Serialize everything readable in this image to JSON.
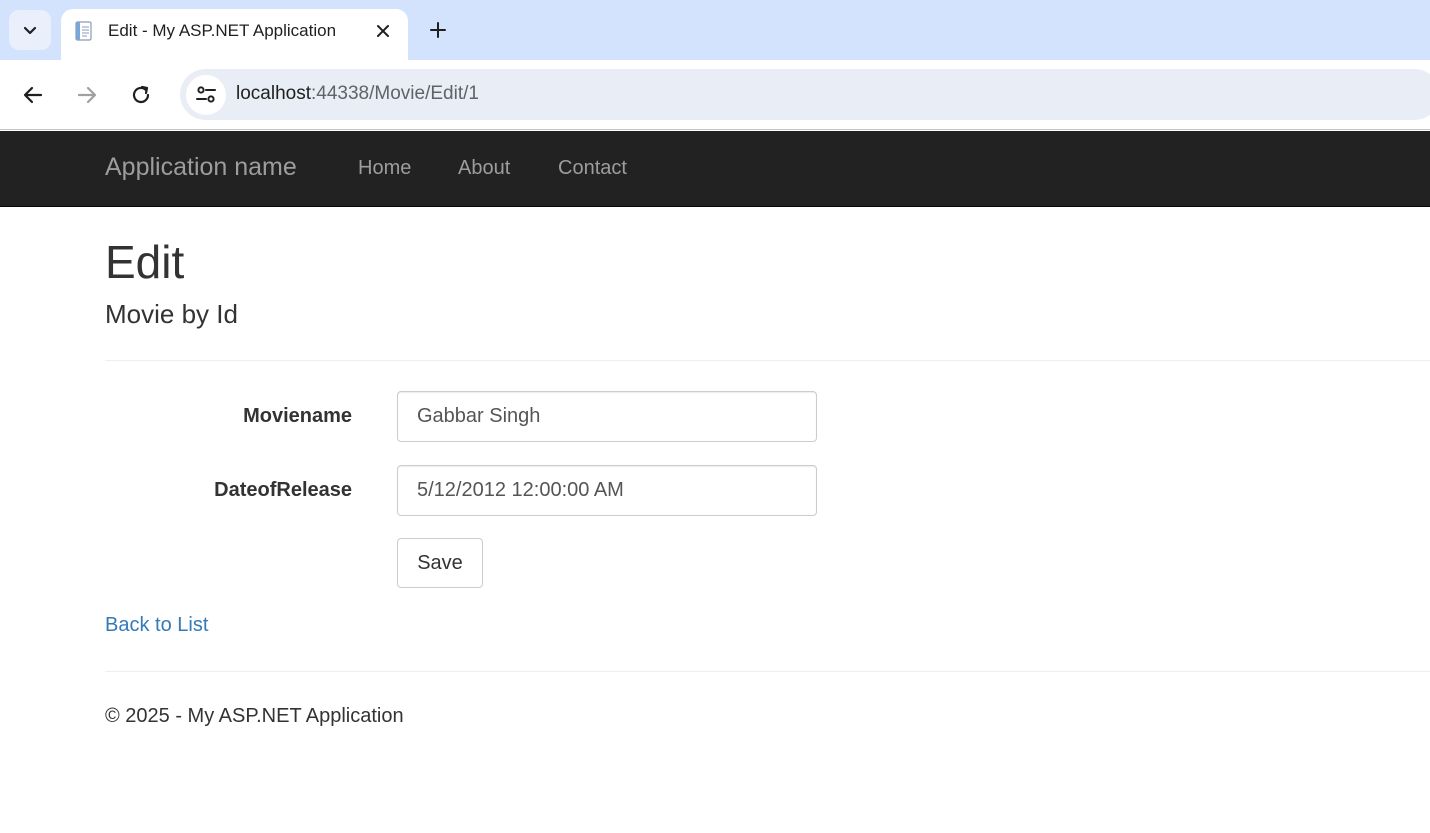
{
  "browser": {
    "tab": {
      "title": "Edit - My ASP.NET Application",
      "favicon": "document-icon"
    },
    "address_bar": {
      "host": "localhost",
      "path": ":44338/Movie/Edit/1"
    },
    "icons": {
      "tab_search": "chevron-down-icon",
      "close_tab": "close-icon",
      "new_tab": "plus-icon",
      "back": "arrow-left-icon",
      "forward": "arrow-right-icon",
      "reload": "reload-icon",
      "site_info": "tune-icon"
    }
  },
  "navbar": {
    "brand": "Application name",
    "links": [
      "Home",
      "About",
      "Contact"
    ],
    "background": "#222222",
    "link_color": "#9d9d9d"
  },
  "main": {
    "title": "Edit",
    "subtitle": "Movie by Id",
    "form": {
      "fields": [
        {
          "label": "Moviename",
          "value": "Gabbar Singh"
        },
        {
          "label": "DateofRelease",
          "value": "5/12/2012 12:00:00 AM"
        }
      ],
      "save_label": "Save"
    },
    "back_link": "Back to List"
  },
  "footer": {
    "text": "© 2025 - My ASP.NET Application"
  },
  "colors": {
    "link": "#337ab7",
    "tabstrip": "#d3e3fd",
    "omnibox": "#e9eef6"
  }
}
